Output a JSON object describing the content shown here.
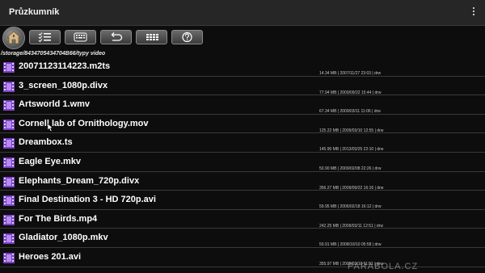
{
  "app": {
    "title": "Průzkumník"
  },
  "toolbar": {
    "buttons": [
      {
        "icon": "home-icon"
      },
      {
        "icon": "checklist-icon"
      },
      {
        "icon": "keyboard-icon"
      },
      {
        "icon": "back-arrow-icon"
      },
      {
        "icon": "grid-icon"
      },
      {
        "icon": "help-icon"
      }
    ]
  },
  "path": "/storage/8434705434704B66/typy video",
  "files": [
    {
      "name": "20071123114223.m2ts",
      "meta": "14.34 MB | 2007/11/27 23:03 | drw"
    },
    {
      "name": "3_screen_1080p.divx",
      "meta": "77.94 MB | 2009/09/22 15:44 | drw"
    },
    {
      "name": "Artsworld 1.wmv",
      "meta": "67.34 MB | 2009/03/11 11:06 | drw"
    },
    {
      "name": "Cornell lab of Ornithology.mov",
      "meta": "125.22 MB | 2009/03/10 12:55 | drw"
    },
    {
      "name": "Dreambox.ts",
      "meta": "145.90 MB | 2013/03/25 22:10 | drw"
    },
    {
      "name": "Eagle Eye.mkv",
      "meta": "50.90 MB | 2009/02/08 22:26 | drw"
    },
    {
      "name": "Elephants_Dream_720p.divx",
      "meta": "356.27 MB | 2009/09/22 16:16 | drw"
    },
    {
      "name": "Final Destination 3 - HD 720p.avi",
      "meta": "59.95 MB | 2006/02/18 16:12 | drw"
    },
    {
      "name": "For The Birds.mp4",
      "meta": "242.25 MB | 2009/03/11 12:51 | drw"
    },
    {
      "name": "Gladiator_1080p.mkv",
      "meta": "50.91 MB | 2008/10/10 05:58 | drw"
    },
    {
      "name": "Heroes 201.avi",
      "meta": "355.97 MB | 2009/03/10 11:51 | drw"
    }
  ],
  "watermark": "PARABOLA.CZ",
  "colors": {
    "background": "#0d0d0d",
    "titlebar": "#262626",
    "file_icon": "#7a3fc4",
    "separator": "#3a3a3a"
  }
}
